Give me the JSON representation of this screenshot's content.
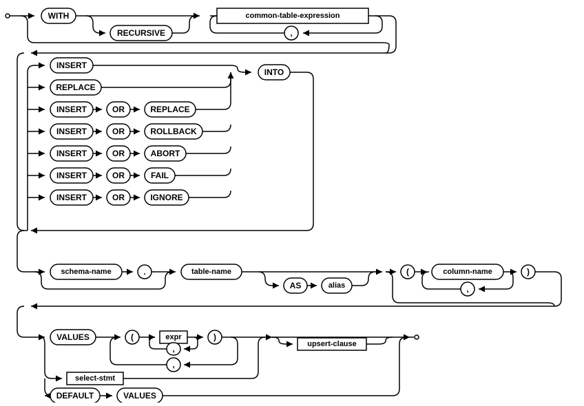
{
  "diagram": {
    "type": "railroad-syntax-diagram",
    "statement": "insert-stmt",
    "tokens": {
      "with": "WITH",
      "recursive": "RECURSIVE",
      "insert": "INSERT",
      "replace": "REPLACE",
      "or": "OR",
      "rollback": "ROLLBACK",
      "abort": "ABORT",
      "fail": "FAIL",
      "ignore": "IGNORE",
      "into": "INTO",
      "as": "AS",
      "values": "VALUES",
      "default": "DEFAULT",
      "dot": ".",
      "comma": ",",
      "lparen": "(",
      "rparen": ")"
    },
    "refs": {
      "cte": "common-table-expression",
      "schema_name": "schema-name",
      "table_name": "table-name",
      "alias": "alias",
      "column_name": "column-name",
      "expr": "expr",
      "select_stmt": "select-stmt",
      "upsert_clause": "upsert-clause"
    }
  }
}
